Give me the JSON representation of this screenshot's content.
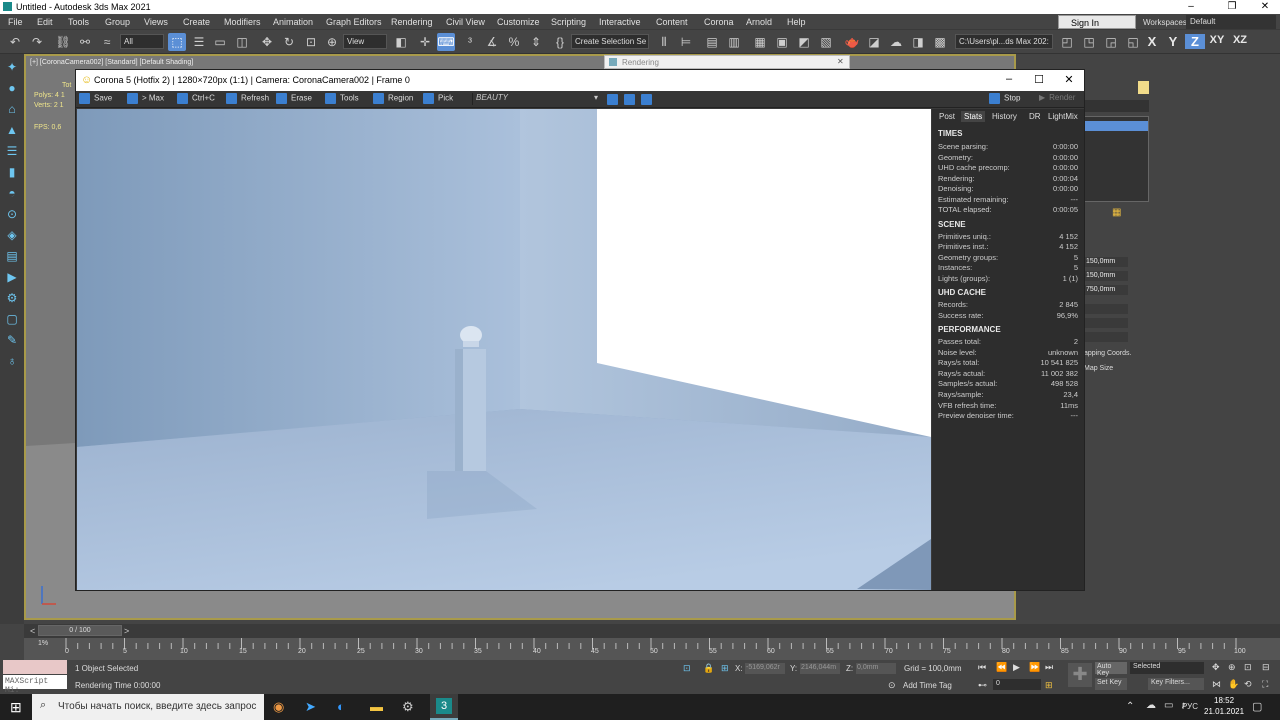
{
  "window": {
    "title": "Untitled - Autodesk 3ds Max 2021"
  },
  "menu": [
    "File",
    "Edit",
    "Tools",
    "Group",
    "Views",
    "Create",
    "Modifiers",
    "Animation",
    "Graph Editors",
    "Rendering",
    "Civil View",
    "Customize",
    "Scripting",
    "Interactive",
    "Content",
    "Corona",
    "Arnold",
    "Help"
  ],
  "account": {
    "signin": "Sign In",
    "workspaces_label": "Workspaces:",
    "workspace": "Default"
  },
  "toolbar": {
    "filter": "All",
    "view": "View",
    "selection_set": "Create Selection Se",
    "path": "C:\\Users\\pl...ds Max 202:",
    "axes": [
      "X",
      "Y",
      "Z",
      "XY",
      "XZ"
    ]
  },
  "viewport": {
    "label": "[+] [CoronaCamera002] [Standard] [Default Shading]",
    "stats": [
      "Tot",
      "Polys:  4 1",
      "Verts:  2 1",
      "FPS:   0,6"
    ]
  },
  "rendering_tab": "Rendering",
  "vfb": {
    "title": "Corona 5 (Hotfix 2) | 1280×720px (1:1) | Camera: CoronaCamera002 | Frame 0",
    "buttons": [
      "Save",
      "> Max",
      "Ctrl+C",
      "Refresh",
      "Erase",
      "Tools",
      "Region",
      "Pick"
    ],
    "channel": "BEAUTY",
    "stop": "Stop",
    "render": "Render",
    "tabs": [
      "Post",
      "Stats",
      "History",
      "DR",
      "LightMix"
    ],
    "stats": {
      "times_header": "TIMES",
      "times": [
        [
          "Scene parsing:",
          "0:00:00"
        ],
        [
          "Geometry:",
          "0:00:00"
        ],
        [
          "UHD cache precomp:",
          "0:00:00"
        ],
        [
          "Rendering:",
          "0:00:04"
        ],
        [
          "Denoising:",
          "0:00:00"
        ],
        [
          "Estimated remaining:",
          "---"
        ],
        [
          "TOTAL elapsed:",
          "0:00:05"
        ]
      ],
      "scene_header": "SCENE",
      "scene": [
        [
          "Primitives uniq.:",
          "4 152"
        ],
        [
          "Primitives inst.:",
          "4 152"
        ],
        [
          "Geometry groups:",
          "5"
        ],
        [
          "Instances:",
          "5"
        ],
        [
          "Lights (groups):",
          "1 (1)"
        ]
      ],
      "uhd_header": "UHD CACHE",
      "uhd": [
        [
          "Records:",
          "2 845"
        ],
        [
          "Success rate:",
          "96,9%"
        ]
      ],
      "perf_header": "PERFORMANCE",
      "perf": [
        [
          "Passes total:",
          "2"
        ],
        [
          "Noise level:",
          "unknown"
        ],
        [
          "Rays/s total:",
          "10 541 825"
        ],
        [
          "Rays/s actual:",
          "11 002 382"
        ],
        [
          "Samples/s actual:",
          "498 528"
        ],
        [
          "Rays/sample:",
          "23,4"
        ],
        [
          "VFB refresh time:",
          "11ms"
        ],
        [
          "Preview denoiser time:",
          "---"
        ]
      ]
    }
  },
  "right_panel": {
    "fields": [
      "150,0mm",
      "150,0mm",
      "750,0mm"
    ],
    "labels": [
      "apping Coords.",
      "Map Size"
    ]
  },
  "timeline": {
    "frame": "0 / 100",
    "ticks": [
      "0",
      "5",
      "10",
      "15",
      "20",
      "25",
      "30",
      "35",
      "40",
      "45",
      "50",
      "55",
      "60",
      "65",
      "70",
      "75",
      "80",
      "85",
      "90",
      "95",
      "100"
    ]
  },
  "status": {
    "maxscript": "MAXScript Mi:",
    "selected": "1 Object Selected",
    "render_time": "Rendering Time  0:00:00",
    "x_label": "X:",
    "x_val": "-5169,062r",
    "y_label": "Y:",
    "y_val": "2146,044m",
    "z_label": "Z:",
    "z_val": "0,0mm",
    "grid": "Grid = 100,0mm",
    "add_time_tag": "Add Time Tag",
    "auto_key": "Auto Key",
    "set_key": "Set Key",
    "key_mode": "Selected",
    "key_filters": "Key Filters...",
    "frame_field": "0"
  },
  "taskbar": {
    "search": "Чтобы начать поиск, введите здесь запрос",
    "lang": "РУС",
    "time": "18:52",
    "date": "21.01.2021"
  }
}
